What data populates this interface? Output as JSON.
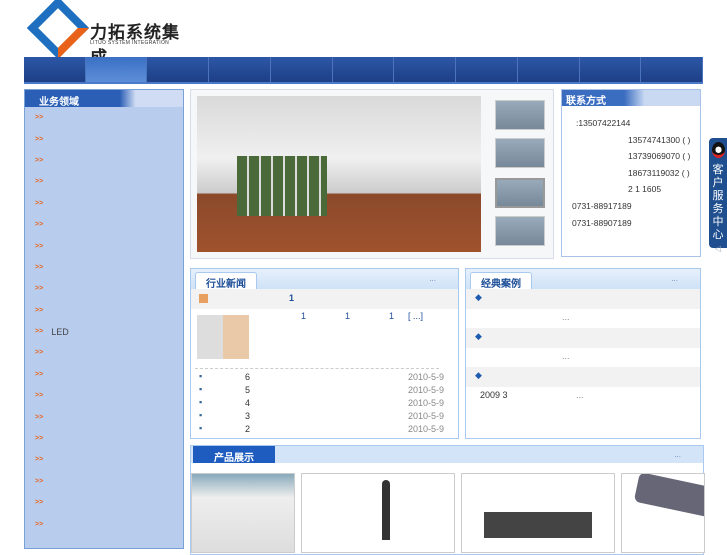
{
  "logo": {
    "cn": "力拓系统集成",
    "en": "LITUO SYSTEM INTEGRATION"
  },
  "nav": {
    "count": 11,
    "active": 1
  },
  "sidebar": {
    "title": "业务领域",
    "arrow": ">>",
    "items": [
      "",
      "",
      "",
      "",
      "",
      "",
      "",
      "",
      "",
      "",
      "LED",
      "",
      "",
      "",
      "",
      "",
      "",
      "",
      "",
      ""
    ]
  },
  "contact": {
    "title": "联系方式",
    "lines": [
      ":13507422144",
      "13574741300 ( )",
      "13739069070 ( )",
      "18673119032 ( )",
      "2 1  1605",
      "0731-88917189",
      "0731-88907189"
    ]
  },
  "service_tab": {
    "label": "客户服务中心",
    "arrow": "◁"
  },
  "news": {
    "title": "行业新闻",
    "more": "...",
    "headline": "1",
    "summary": [
      "1",
      "1",
      "1",
      "[ ...]"
    ],
    "items": [
      {
        "t": "6",
        "d": "2010-5-9"
      },
      {
        "t": "5",
        "d": "2010-5-9"
      },
      {
        "t": "4",
        "d": "2010-5-9"
      },
      {
        "t": "3",
        "d": "2010-5-9"
      },
      {
        "t": "2",
        "d": "2010-5-9"
      }
    ]
  },
  "cases": {
    "title": "经典案例",
    "more": "...",
    "rows": [
      {
        "sub": "..."
      },
      {
        "sub": "..."
      },
      {
        "sub_a": "2009 3",
        "sub": "..."
      }
    ]
  },
  "products": {
    "title": "产品展示",
    "more": "..."
  }
}
